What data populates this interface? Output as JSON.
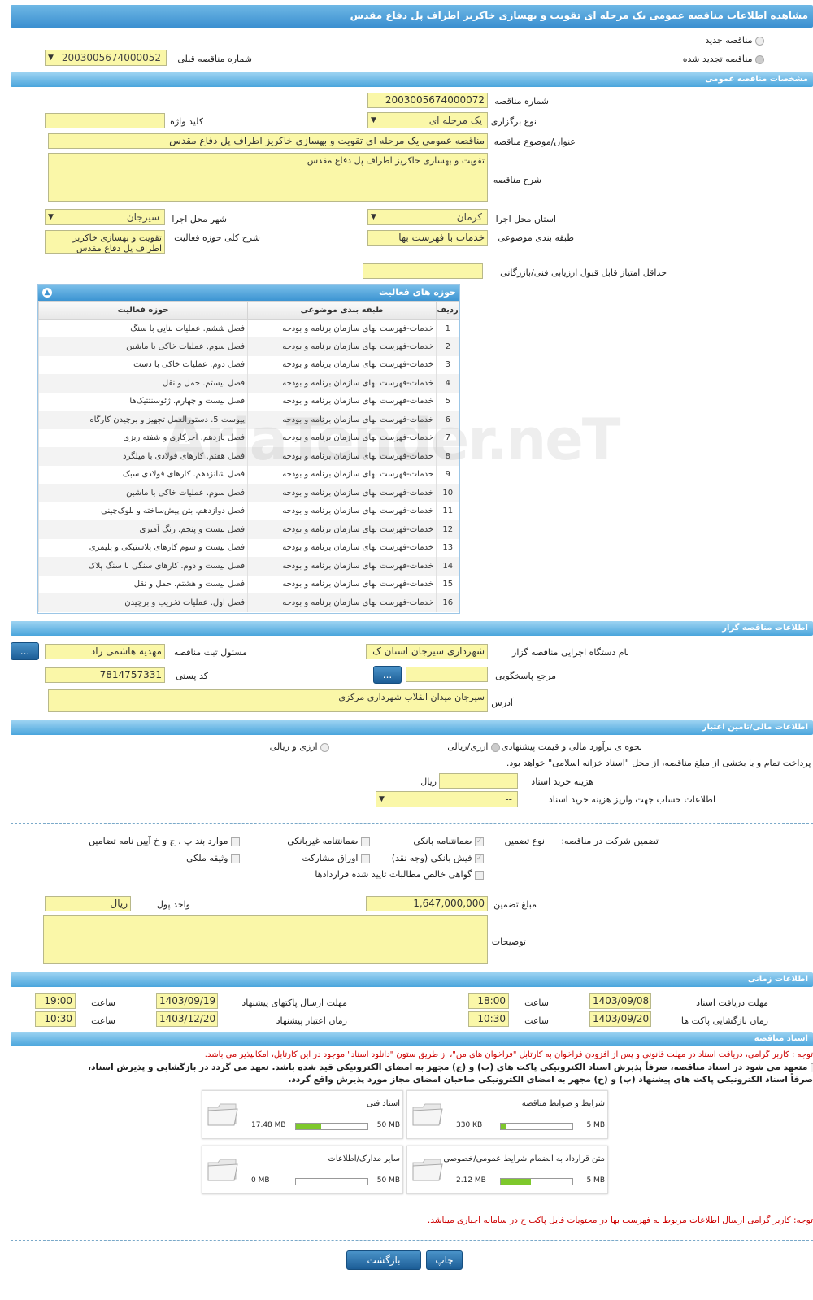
{
  "page_title": "مشاهده اطلاعات مناقصه عمومی یک مرحله ای تقویت و بهسازی خاکریز اطراف پل دفاع مقدس",
  "tender_kind": {
    "new_label": "مناقصه جدید",
    "renewed_label": "مناقصه تجدید شده",
    "prev_number_label": "شماره مناقصه قبلی",
    "prev_number_value": "2003005674000052"
  },
  "general": {
    "header": "مشخصات مناقصه عمومی",
    "number_label": "شماره مناقصه",
    "number_value": "2003005674000072",
    "type_label": "نوع برگزاری",
    "type_value": "یک مرحله ای",
    "keyword_label": "کلید واژه",
    "keyword_value": "",
    "title_label": "عنوان/موضوع مناقصه",
    "title_value": "مناقصه عمومی یک مرحله ای تقویت و بهسازی خاکریز اطراف پل دفاع مقدس",
    "desc_label": "شرح مناقصه",
    "desc_value": "تقویت و بهسازی خاکریز اطراف پل دفاع مقدس",
    "province_label": "استان محل اجرا",
    "province_value": "کرمان",
    "city_label": "شهر محل اجرا",
    "city_value": "سیرجان",
    "category_label": "طبقه بندی موضوعی",
    "category_value": "خدمات با فهرست بها",
    "activity_desc_label": "شرح کلی حوزه فعالیت",
    "activity_desc_value": "تقویت و بهسازی خاکریز اطراف پل دفاع مقدس",
    "min_score_label": "حداقل امتیاز قابل قبول ارزیابی فنی/بازرگانی",
    "min_score_value": ""
  },
  "activities": {
    "header": "حوزه های فعالیت",
    "col_row": "ردیف",
    "col_category": "طبقه بندی موضوعی",
    "col_activity": "حوزه فعالیت",
    "rows": [
      {
        "n": "1",
        "cat": "خدمات-فهرست بهای سازمان برنامه و بودجه",
        "act": "فصل ششم. عملیات بنایی با سنگ"
      },
      {
        "n": "2",
        "cat": "خدمات-فهرست بهای سازمان برنامه و بودجه",
        "act": "فصل سوم. عملیات خاکی با ماشین"
      },
      {
        "n": "3",
        "cat": "خدمات-فهرست بهای سازمان برنامه و بودجه",
        "act": "فصل دوم. عملیات خاکی با دست"
      },
      {
        "n": "4",
        "cat": "خدمات-فهرست بهای سازمان برنامه و بودجه",
        "act": "فصل بیستم. حمل و نقل"
      },
      {
        "n": "5",
        "cat": "خدمات-فهرست بهای سازمان برنامه و بودجه",
        "act": "فصل بیست و چهارم. ژئوسنتتیک‌ها"
      },
      {
        "n": "6",
        "cat": "خدمات-فهرست بهای سازمان برنامه و بودجه",
        "act": "پیوست 5. دستورالعمل تجهیز و برچیدن کارگاه"
      },
      {
        "n": "7",
        "cat": "خدمات-فهرست بهای سازمان برنامه و بودجه",
        "act": "فصل یازدهم. آجرکاری و شفته ریزی"
      },
      {
        "n": "8",
        "cat": "خدمات-فهرست بهای سازمان برنامه و بودجه",
        "act": "فصل هفتم. کارهای فولادی با میلگرد"
      },
      {
        "n": "9",
        "cat": "خدمات-فهرست بهای سازمان برنامه و بودجه",
        "act": "فصل شانزدهم. کارهای فولادی سبک"
      },
      {
        "n": "10",
        "cat": "خدمات-فهرست بهای سازمان برنامه و بودجه",
        "act": "فصل سوم. عملیات خاکی با ماشین"
      },
      {
        "n": "11",
        "cat": "خدمات-فهرست بهای سازمان برنامه و بودجه",
        "act": "فصل دوازدهم. بتن پیش‌ساخته و بلوک‌چینی"
      },
      {
        "n": "12",
        "cat": "خدمات-فهرست بهای سازمان برنامه و بودجه",
        "act": "فصل بیست و پنجم. رنگ آمیزی"
      },
      {
        "n": "13",
        "cat": "خدمات-فهرست بهای سازمان برنامه و بودجه",
        "act": "فصل بیست و سوم کارهای پلاستیکی و پلیمری"
      },
      {
        "n": "14",
        "cat": "خدمات-فهرست بهای سازمان برنامه و بودجه",
        "act": "فصل بیست و دوم. کارهای سنگی با سنگ پلاک"
      },
      {
        "n": "15",
        "cat": "خدمات-فهرست بهای سازمان برنامه و بودجه",
        "act": "فصل بیست و هشتم. حمل و نقل"
      },
      {
        "n": "16",
        "cat": "خدمات-فهرست بهای سازمان برنامه و بودجه",
        "act": "فصل اول. عملیات تخریب و برچیدن"
      }
    ]
  },
  "organizer": {
    "header": "اطلاعات مناقصه گزار",
    "org_label": "نام دستگاه اجرایی مناقصه گزار",
    "org_value": "شهرداری سیرجان استان ک",
    "registrar_label": "مسئول ثبت مناقصه",
    "registrar_value": "مهدیه هاشمی راد",
    "ref_label": "مرجع پاسخگویی",
    "ref_value": "",
    "postal_label": "کد پستی",
    "postal_value": "7814757331",
    "address_label": "آدرس",
    "address_value": "سیرجان میدان انقلاب شهرداری مرکزی",
    "more_btn": "..."
  },
  "finance": {
    "header": "اطلاعات مالی/تامین اعتبار",
    "estimate_label": "نحوه ی برآورد مالی و قیمت پیشنهادی",
    "opt1": "ارزی/ریالی",
    "opt2": "ارزی و ریالی",
    "islamic_label": "پرداخت تمام و یا بخشی از مبلغ مناقصه، از محل \"اسناد خزانه اسلامی\" خواهد بود.",
    "doc_fee_label": "هزینه خرید اسناد",
    "doc_fee_value": "",
    "doc_fee_unit": "ریال",
    "account_label": "اطلاعات حساب جهت واریز هزینه خرید اسناد",
    "account_value": "--",
    "guarantee_label": "تضمین شرکت در مناقصه:",
    "guarantee_type_label": "نوع تضمین",
    "g_bank": "ضمانتنامه بانکی",
    "g_nonbank": "ضمانتنامه غیربانکی",
    "g_clause": "موارد بند پ ، ج و خ آیین نامه تضامین",
    "g_check": "فیش بانکی (وجه نقد)",
    "g_bonds": "اوراق مشارکت",
    "g_property": "وثیقه ملکی",
    "g_receivable": "گواهی خالص مطالبات تایید شده قراردادها",
    "amount_label": "مبلغ تضمین",
    "amount_value": "1,647,000,000",
    "currency_label": "واحد پول",
    "currency_value": "ریال",
    "notes_label": "توضیحات",
    "notes_value": ""
  },
  "timing": {
    "header": "اطلاعات زمانی",
    "receive_label": "مهلت دریافت اسناد",
    "receive_date": "1403/09/08",
    "receive_time": "18:00",
    "send_label": "مهلت ارسال پاکتهای پیشنهاد",
    "send_date": "1403/09/19",
    "send_time": "19:00",
    "open_label": "زمان بازگشایی پاکت ها",
    "open_date": "1403/09/20",
    "open_time": "10:30",
    "validity_label": "زمان اعتبار پیشنهاد",
    "validity_date": "1403/12/20",
    "validity_time": "10:30",
    "time_label": "ساعت"
  },
  "documents": {
    "header": "اسناد مناقصه",
    "note1": "توجه : کاربر گرامی، دریافت اسناد در مهلت قانونی و پس از افزودن فراخوان به کارتابل \"فراخوان های من\"، از طریق ستون \"دانلود اسناد\" موجود در این کارتابل، امکانپذیر می باشد.",
    "commit1": "متعهد می شود در اسناد مناقصه، صرفاً پذیرش اسناد الکترونیکی پاکت های (ب) و (ج) مجهز به امضای الکترونیکی قید شده باشد. تعهد می گردد در بازگشایی و پذیرش اسناد،",
    "commit2": "صرفاً اسناد الکترونیکی پاکت های پیشنهاد (ب) و (ج) مجهز به امضای الکترونیکی صاحبان امضای مجاز مورد پذیرش واقع گردد.",
    "files": [
      {
        "title": "شرایط و ضوابط مناقصه",
        "size": "330 KB",
        "max": "5 MB",
        "fill": 0.064
      },
      {
        "title": "اسناد فنی",
        "size": "17.48 MB",
        "max": "50 MB",
        "fill": 0.35
      },
      {
        "title": "متن قرارداد به انضمام شرایط عمومی/خصوصی",
        "size": "2.12 MB",
        "max": "5 MB",
        "fill": 0.42
      },
      {
        "title": "سایر مدارک/اطلاعات",
        "size": "0 MB",
        "max": "50 MB",
        "fill": 0
      }
    ],
    "note2": "توجه: کاربر گرامی ارسال اطلاعات مربوط به فهرست بها در محتویات فایل پاکت ج در سامانه اجباری میباشد."
  },
  "actions": {
    "print": "چاپ",
    "back": "بازگشت"
  },
  "watermark": "AriaTender.neT"
}
